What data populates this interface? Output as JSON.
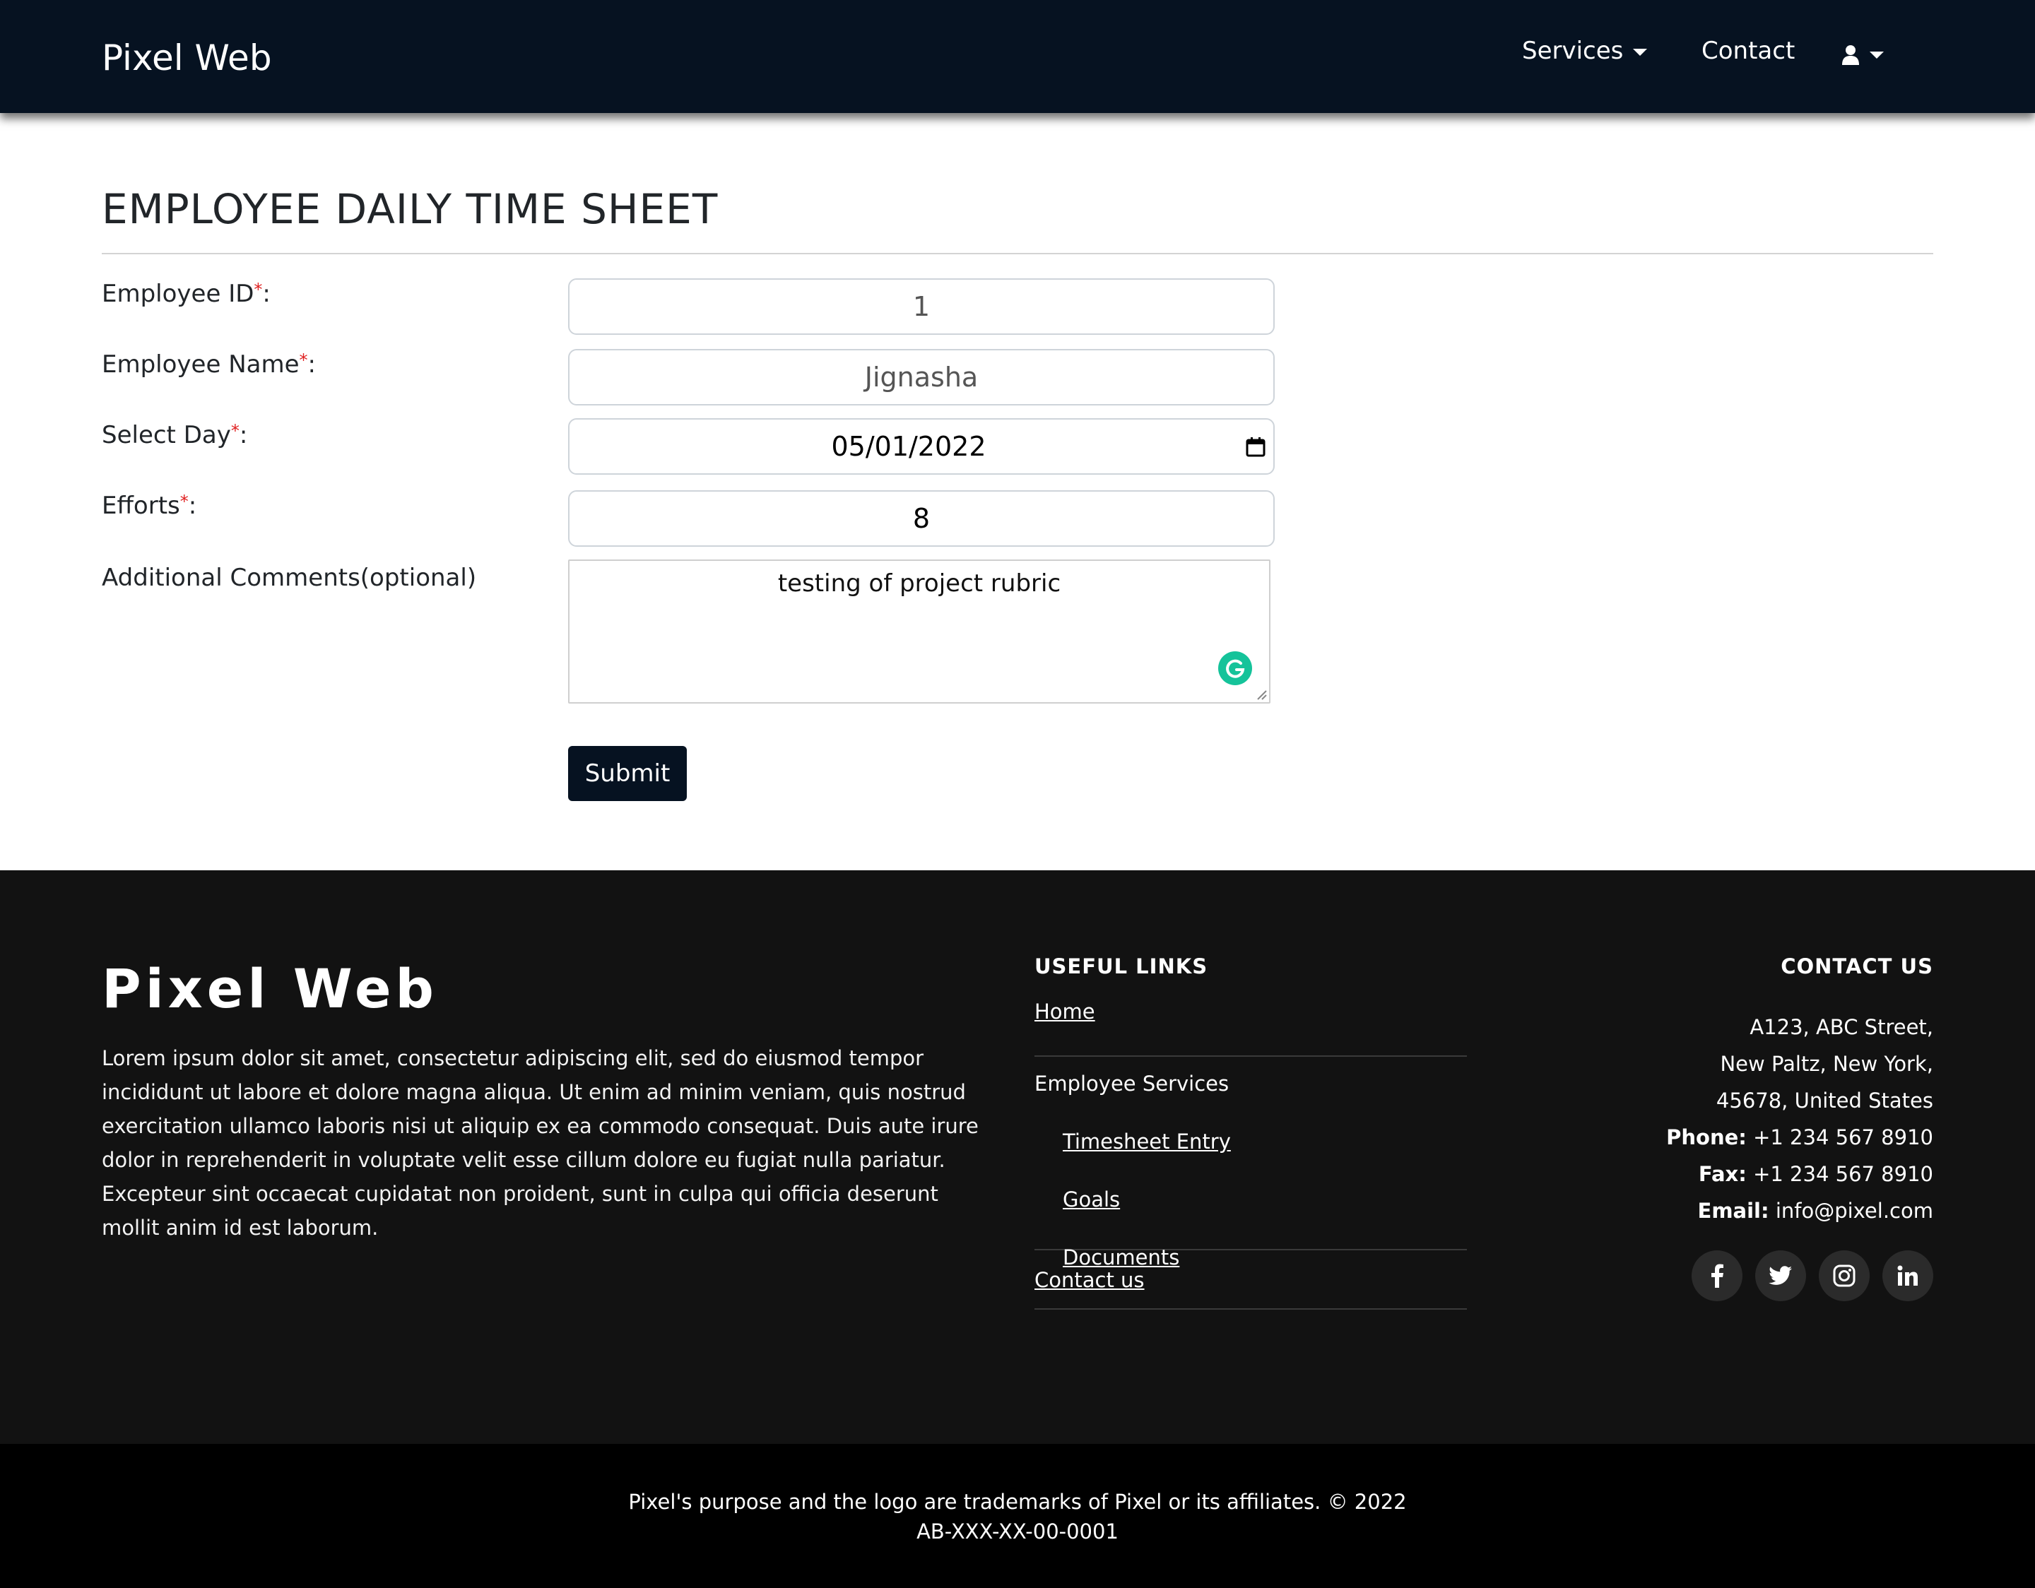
{
  "navbar": {
    "brand": "Pixel Web",
    "services_label": "Services",
    "contact_label": "Contact"
  },
  "form": {
    "title": "EMPLOYEE DAILY TIME SHEET",
    "required_mark": "*",
    "fields": {
      "employee_id": {
        "label": "Employee ID",
        "suffix": ":",
        "value": "1"
      },
      "employee_name": {
        "label": "Employee Name",
        "suffix": ":",
        "value": "Jignasha"
      },
      "select_day": {
        "label": "Select Day",
        "suffix": ":",
        "value": "05/01/2022"
      },
      "efforts": {
        "label": "Efforts",
        "suffix": ":",
        "value": "8"
      },
      "comments": {
        "label": "Additional Comments(optional)",
        "value": "testing of project rubric"
      }
    },
    "submit_label": "Submit"
  },
  "footer": {
    "brand": "Pixel Web",
    "about": "Lorem ipsum dolor sit amet, consectetur adipiscing elit, sed do eiusmod tempor incididunt ut labore et dolore magna aliqua. Ut enim ad minim veniam, quis nostrud exercitation ullamco laboris nisi ut aliquip ex ea commodo consequat. Duis aute irure dolor in reprehenderit in voluptate velit esse cillum dolore eu fugiat nulla pariatur. Excepteur sint occaecat cupidatat non proident, sunt in culpa qui officia deserunt mollit anim id est laborum.",
    "useful_links": {
      "heading": "USEFUL LINKS",
      "home": "Home",
      "employee_services": "Employee Services",
      "sub_links": [
        "Timesheet Entry",
        "Goals",
        "Documents"
      ],
      "contact_us": "Contact us"
    },
    "contact": {
      "heading": "CONTACT US",
      "address_line1": "A123, ABC Street,",
      "address_line2": "New Paltz, New York,",
      "address_line3": "45678, United States",
      "phone_label": "Phone:",
      "phone": "+1 234 567 8910",
      "fax_label": "Fax:",
      "fax": "+1 234 567 8910",
      "email_label": "Email:",
      "email": "info@pixel.com"
    },
    "social_icons": [
      "facebook-icon",
      "twitter-icon",
      "instagram-icon",
      "linkedin-icon"
    ],
    "copyright_line1": "Pixel's purpose and the logo are trademarks of Pixel or its affiliates. © 2022",
    "copyright_line2": "AB-XXX-XX-00-0001"
  },
  "colors": {
    "navbar_bg": "#061221",
    "footer_bg": "#121212",
    "footer_bottom_bg": "#000000",
    "required": "#e02020",
    "grammarly": "#15c39a"
  }
}
